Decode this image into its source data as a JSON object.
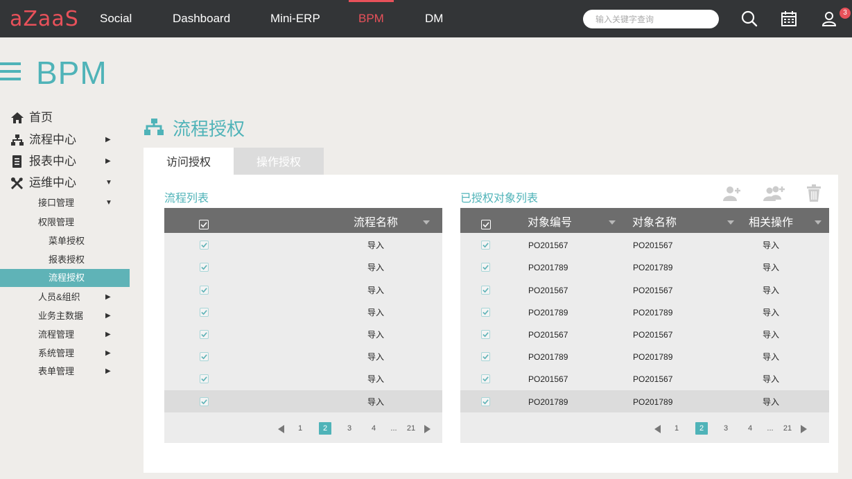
{
  "app": {
    "logo": "aZaaS"
  },
  "nav": {
    "items": [
      {
        "label": "Social"
      },
      {
        "label": "Dashboard"
      },
      {
        "label": "Mini-ERP"
      },
      {
        "label": "BPM"
      },
      {
        "label": "DM"
      }
    ],
    "search_placeholder": "输入关键字查询",
    "notification_count": "3"
  },
  "header": {
    "title": "BPM"
  },
  "sidebar": {
    "items": [
      {
        "label": "首页"
      },
      {
        "label": "流程中心"
      },
      {
        "label": "报表中心"
      },
      {
        "label": "运维中心"
      }
    ],
    "sub": [
      {
        "label": "接口管理"
      },
      {
        "label": "权限管理"
      },
      {
        "label": "菜单授权"
      },
      {
        "label": "报表授权"
      },
      {
        "label": "流程授权"
      },
      {
        "label": "人员&组织"
      },
      {
        "label": "业务主数据"
      },
      {
        "label": "流程管理"
      },
      {
        "label": "系统管理"
      },
      {
        "label": "表单管理"
      }
    ]
  },
  "page": {
    "title": "流程授权",
    "tabs": [
      {
        "label": "访问授权"
      },
      {
        "label": "操作授权"
      }
    ]
  },
  "left_table": {
    "title": "流程列表",
    "header": "流程名称",
    "rows": [
      "导入",
      "导入",
      "导入",
      "导入",
      "导入",
      "导入",
      "导入",
      "导入"
    ],
    "pager": {
      "pages": [
        "1",
        "2",
        "3",
        "4",
        "...",
        "21"
      ],
      "current": "2"
    }
  },
  "right_table": {
    "title": "已授权对象列表",
    "headers": [
      "对象编号",
      "对象名称",
      "相关操作"
    ],
    "rows": [
      {
        "id": "PO201567",
        "name": "PO201567",
        "op": "导入"
      },
      {
        "id": "PO201789",
        "name": "PO201789",
        "op": "导入"
      },
      {
        "id": "PO201567",
        "name": "PO201567",
        "op": "导入"
      },
      {
        "id": "PO201789",
        "name": "PO201789",
        "op": "导入"
      },
      {
        "id": "PO201567",
        "name": "PO201567",
        "op": "导入"
      },
      {
        "id": "PO201789",
        "name": "PO201789",
        "op": "导入"
      },
      {
        "id": "PO201567",
        "name": "PO201567",
        "op": "导入"
      },
      {
        "id": "PO201789",
        "name": "PO201789",
        "op": "导入"
      }
    ],
    "pager": {
      "pages": [
        "1",
        "2",
        "3",
        "4",
        "...",
        "21"
      ],
      "current": "2"
    }
  },
  "colors": {
    "accent": "#4fb3b8",
    "brand": "#e8515a",
    "topbar": "#333537"
  }
}
